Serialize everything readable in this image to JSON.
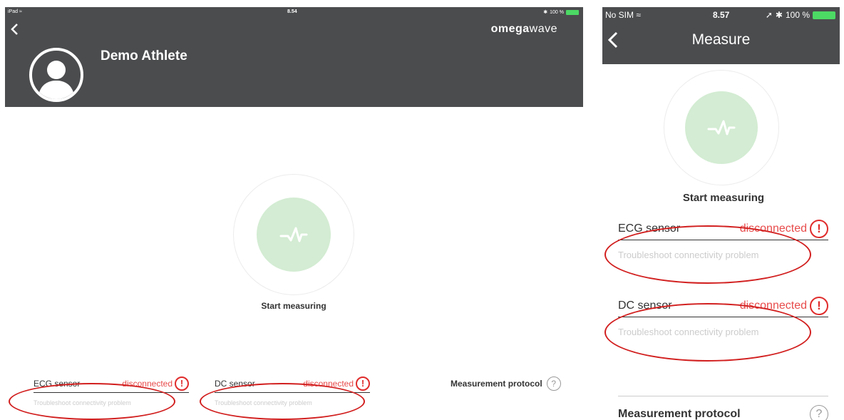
{
  "ipad": {
    "status": {
      "device": "iPad",
      "time": "8.54",
      "battery": "100 %"
    },
    "logo": {
      "part1": "omega",
      "part2": "wave"
    },
    "athlete_name": "Demo Athlete",
    "start_label": "Start measuring",
    "sensors": [
      {
        "label": "ECG sensor",
        "status": "disconnected",
        "trouble": "Troubleshoot connectivity problem"
      },
      {
        "label": "DC sensor",
        "status": "disconnected",
        "trouble": "Troubleshoot connectivity problem"
      }
    ],
    "protocol_label": "Measurement protocol",
    "help_glyph": "?"
  },
  "phone": {
    "status": {
      "carrier": "No SIM",
      "time": "8.57",
      "battery": "100 %"
    },
    "title": "Measure",
    "start_label": "Start measuring",
    "sensors": [
      {
        "label": "ECG sensor",
        "status": "disconnected",
        "trouble": "Troubleshoot connectivity problem"
      },
      {
        "label": "DC sensor",
        "status": "disconnected",
        "trouble": "Troubleshoot connectivity problem"
      }
    ],
    "protocol_label": "Measurement protocol",
    "help_glyph": "?"
  },
  "warning_glyph": "!",
  "colors": {
    "header": "#4b4c4e",
    "accent_green": "#d3ecd3",
    "error_red": "#e84b4b",
    "annotation_red": "#d21f1f"
  }
}
